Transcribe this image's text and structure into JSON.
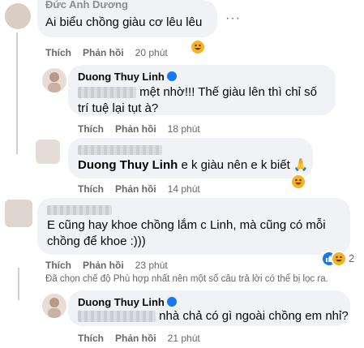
{
  "comments": [
    {
      "author": "Đức Anh Dương",
      "text": "Ai biểu chồng giàu cơ lêu lêu",
      "like_label": "Thích",
      "reply_label": "Phản hồi",
      "time": "20 phút"
    },
    {
      "author": "Duong Thuy Linh",
      "text": "mệt nhờ!!! Thế giàu lên thì chỉ số trí tuệ lại tụt à?",
      "like_label": "Thích",
      "reply_label": "Phản hồi",
      "time": "18 phút"
    },
    {
      "mention": "Duong Thuy Linh",
      "text": "e k giàu nên e k biết",
      "emoji": "🙏",
      "like_label": "Thích",
      "reply_label": "Phản hồi",
      "time": "14 phút"
    },
    {
      "text": "E cũng hay khoe chồng lắm c Linh, mà cũng có mỗi chồng để khoe :)))",
      "like_label": "Thích",
      "reply_label": "Phản hồi",
      "time": "23 phút",
      "reaction_count": "2"
    },
    {
      "author": "Duong Thuy Linh",
      "text": "nhà chả có gì ngoài chồng em nhỉ?",
      "like_label": "Thích",
      "reply_label": "Phản hồi",
      "time": "21 phút"
    }
  ],
  "filter_notice": "Đã chọn chế độ Phù hợp nhất nên một số câu trả lời có thể bị lọc ra.",
  "colors": {
    "bubble": "#f0f2f5",
    "meta": "#65676b",
    "reaction_blue": "#1877f2",
    "reaction_haha": "#f7b125"
  },
  "icons": [
    "haha-reaction-icon",
    "like-reaction-icon",
    "verified-badge-icon",
    "more-options-icon"
  ]
}
